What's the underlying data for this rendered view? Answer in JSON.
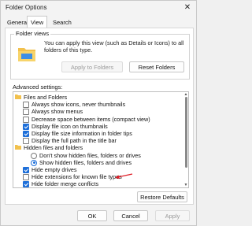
{
  "window": {
    "title": "Folder Options",
    "close": "✕"
  },
  "tabs": [
    "General",
    "View",
    "Search"
  ],
  "folder_views": {
    "label": "Folder views",
    "description": "You can apply this view (such as Details or Icons) to all folders of this type.",
    "apply_button": "Apply to Folders",
    "reset_button": "Reset Folders"
  },
  "advanced": {
    "label": "Advanced settings:",
    "items": [
      {
        "text": "Files and Folders",
        "kind": "folder",
        "checked": false
      },
      {
        "text": "Always show icons, never thumbnails",
        "kind": "check",
        "checked": false
      },
      {
        "text": "Always show menus",
        "kind": "check",
        "checked": false
      },
      {
        "text": "Decrease space between items (compact view)",
        "kind": "check",
        "checked": false
      },
      {
        "text": "Display file icon on thumbnails",
        "kind": "check",
        "checked": true
      },
      {
        "text": "Display file size information in folder tips",
        "kind": "check",
        "checked": true
      },
      {
        "text": "Display the full path in the title bar",
        "kind": "check",
        "checked": false
      },
      {
        "text": "Hidden files and folders",
        "kind": "folder",
        "checked": false
      },
      {
        "text": "Don't show hidden files, folders or drives",
        "kind": "radio",
        "checked": false
      },
      {
        "text": "Show hidden files, folders and drives",
        "kind": "radio",
        "checked": true
      },
      {
        "text": "Hide empty drives",
        "kind": "check",
        "checked": true
      },
      {
        "text": "Hide extensions for known file types",
        "kind": "check",
        "checked": false
      },
      {
        "text": "Hide folder merge conflicts",
        "kind": "check",
        "checked": true
      }
    ]
  },
  "restore_button": "Restore Defaults",
  "footer": {
    "ok": "OK",
    "cancel": "Cancel",
    "apply": "Apply"
  },
  "colors": {
    "accent": "#1e6fd9",
    "annotation": "#e0202a"
  }
}
